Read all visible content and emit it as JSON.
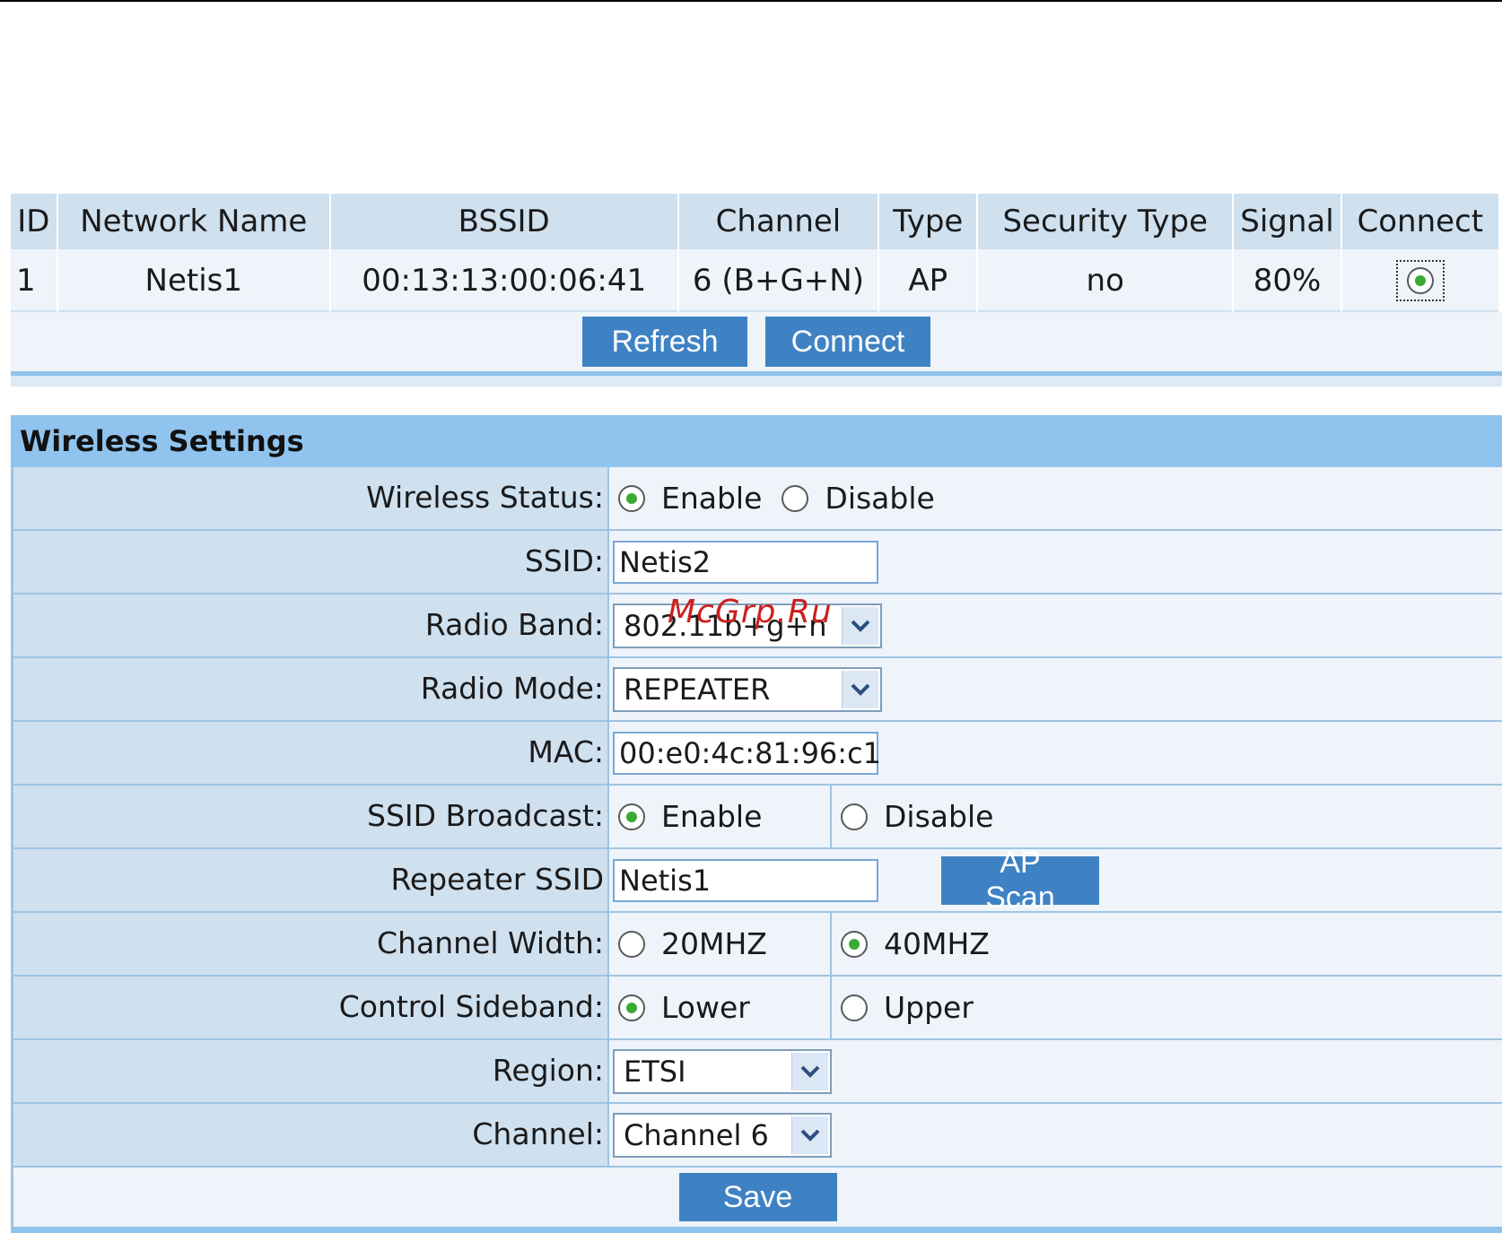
{
  "scan": {
    "headers": [
      "ID",
      "Network Name",
      "BSSID",
      "Channel",
      "Type",
      "Security Type",
      "Signal",
      "Connect"
    ],
    "rows": [
      {
        "id": "1",
        "network_name": "Netis1",
        "bssid": "00:13:13:00:06:41",
        "channel": "6 (B+G+N)",
        "type": "AP",
        "security": "no",
        "signal": "80%",
        "selected": true
      }
    ],
    "refresh_label": "Refresh",
    "connect_label": "Connect"
  },
  "wireless": {
    "title": "Wireless Settings",
    "wireless_status": {
      "label": "Wireless Status:",
      "enable": "Enable",
      "disable": "Disable",
      "selected": "enable"
    },
    "ssid": {
      "label": "SSID:",
      "value": "Netis2"
    },
    "radio_band": {
      "label": "Radio Band:",
      "value": "802.11b+g+n"
    },
    "radio_mode": {
      "label": "Radio Mode:",
      "value": "REPEATER"
    },
    "mac": {
      "label": "MAC:",
      "value": "00:e0:4c:81:96:c1"
    },
    "ssid_broadcast": {
      "label": "SSID Broadcast:",
      "enable": "Enable",
      "disable": "Disable",
      "selected": "enable"
    },
    "repeater_ssid": {
      "label": "Repeater SSID",
      "value": "Netis1",
      "ap_scan_label": "AP Scan"
    },
    "channel_width": {
      "label": "Channel Width:",
      "opt1": "20MHZ",
      "opt2": "40MHZ",
      "selected": "40MHZ"
    },
    "control_sideband": {
      "label": "Control Sideband:",
      "opt1": "Lower",
      "opt2": "Upper",
      "selected": "Lower"
    },
    "region": {
      "label": "Region:",
      "value": "ETSI"
    },
    "channel": {
      "label": "Channel:",
      "value": "Channel 6"
    },
    "save_label": "Save"
  },
  "watermark": "McGrp.Ru",
  "colors": {
    "header_bg": "#cfe0ef",
    "row_bg": "#eef4fa",
    "section_header": "#90c4ee",
    "button": "#3f82c4",
    "radio_dot": "#3aaa35",
    "watermark": "#cc1f1f"
  }
}
